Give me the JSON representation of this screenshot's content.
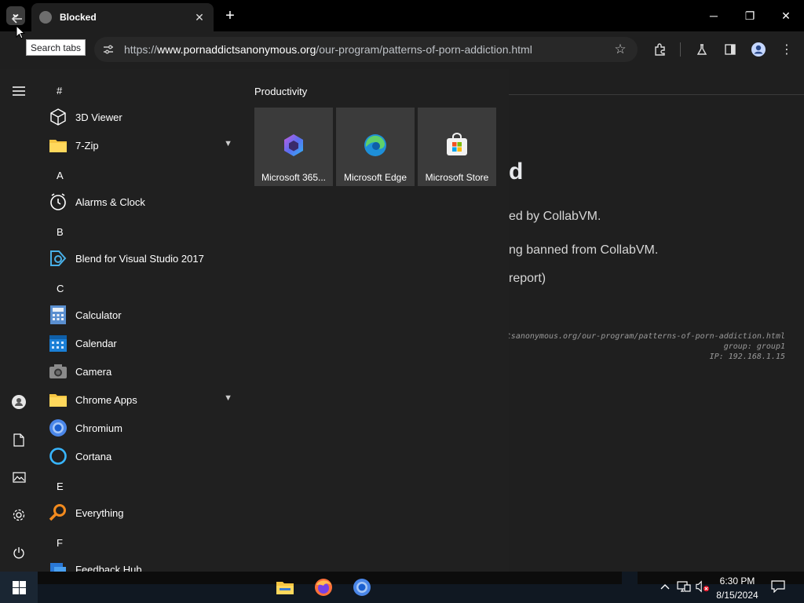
{
  "browser": {
    "tab_title": "Blocked",
    "tab_search_tooltip": "Search tabs",
    "url_scheme": "https://",
    "url_host": "www.pornaddictsanonymous.org",
    "url_path": "/our-program/patterns-of-porn-addiction.html",
    "window_controls": {
      "minimize": "─",
      "restore": "❐",
      "close": "✕"
    }
  },
  "page": {
    "heading_fragment": "d",
    "line1": "ed by CollabVM.",
    "line2": "ng banned from CollabVM.",
    "line3": "report)",
    "mono1": "tsanonymous.org/our-program/patterns-of-porn-addiction.html",
    "mono2": "group: group1",
    "mono3": "IP: 192.168.1.15"
  },
  "start_menu": {
    "group_title": "Productivity",
    "tiles": [
      {
        "label": "Microsoft 365...",
        "icon": "m365-icon"
      },
      {
        "label": "Microsoft Edge",
        "icon": "edge-icon"
      },
      {
        "label": "Microsoft Store",
        "icon": "store-icon"
      }
    ],
    "letters": [
      "#",
      "A",
      "B",
      "C",
      "E",
      "F"
    ],
    "apps": [
      {
        "label": "3D Viewer",
        "icon": "cube-icon"
      },
      {
        "label": "7-Zip",
        "icon": "folder-icon",
        "expandable": true
      },
      {
        "label": "Alarms & Clock",
        "icon": "clock-icon"
      },
      {
        "label": "Blend for Visual Studio 2017",
        "icon": "blend-icon"
      },
      {
        "label": "Calculator",
        "icon": "calculator-icon"
      },
      {
        "label": "Calendar",
        "icon": "calendar-icon"
      },
      {
        "label": "Camera",
        "icon": "camera-icon"
      },
      {
        "label": "Chrome Apps",
        "icon": "folder-icon",
        "expandable": true
      },
      {
        "label": "Chromium",
        "icon": "chromium-icon"
      },
      {
        "label": "Cortana",
        "icon": "cortana-icon"
      },
      {
        "label": "Everything",
        "icon": "search-icon"
      },
      {
        "label": "Feedback Hub",
        "icon": "feedback-icon"
      }
    ]
  },
  "taskbar": {
    "time": "6:30 PM",
    "date": "8/15/2024"
  }
}
